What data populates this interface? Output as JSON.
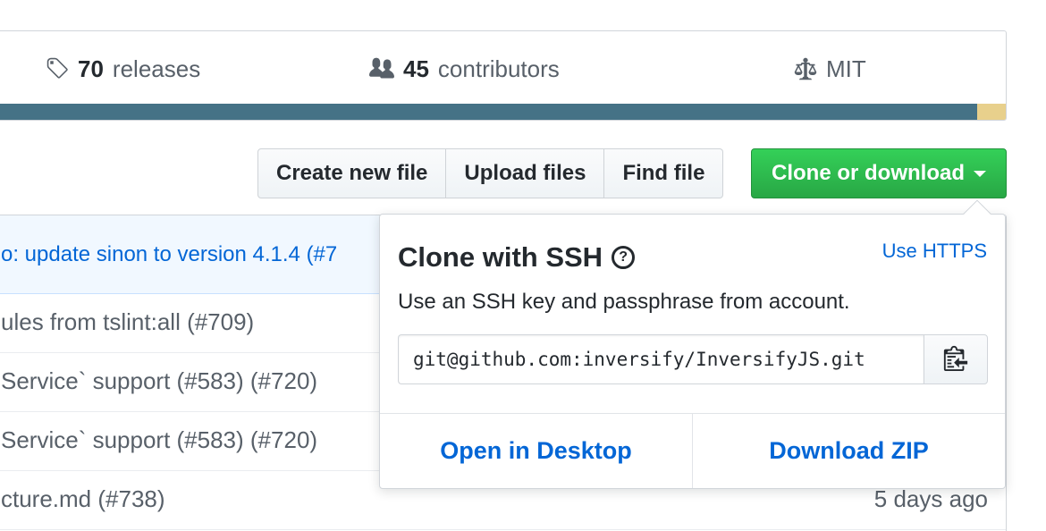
{
  "summary": {
    "releases_count": "70",
    "releases_label": "releases",
    "contributors_count": "45",
    "contributors_label": "contributors",
    "license": "MIT"
  },
  "language_bar": [
    {
      "color": "#457286",
      "share": 0.972
    },
    {
      "color": "#e8d08c",
      "share": 0.028
    }
  ],
  "toolbar": {
    "create_file": "Create new file",
    "upload_files": "Upload files",
    "find_file": "Find file",
    "clone_download": "Clone or download"
  },
  "latest_commit": {
    "message": "o: update sinon to version 4.1.4 (#7"
  },
  "commits": [
    {
      "message": "ules from tslint:all (#709)",
      "age": ""
    },
    {
      "message": "Service` support (#583) (#720)",
      "age": ""
    },
    {
      "message": "Service` support (#583) (#720)",
      "age": ""
    },
    {
      "message": "cture.md (#738)",
      "age": "5 days ago"
    }
  ],
  "clone_panel": {
    "title": "Clone with SSH",
    "switch_label": "Use HTTPS",
    "description": "Use an SSH key and passphrase from account.",
    "url": "git@github.com:inversify/InversifyJS.git",
    "open_desktop": "Open in Desktop",
    "download_zip": "Download ZIP"
  },
  "colors": {
    "accent": "#0366d6",
    "green": "#28a745"
  }
}
